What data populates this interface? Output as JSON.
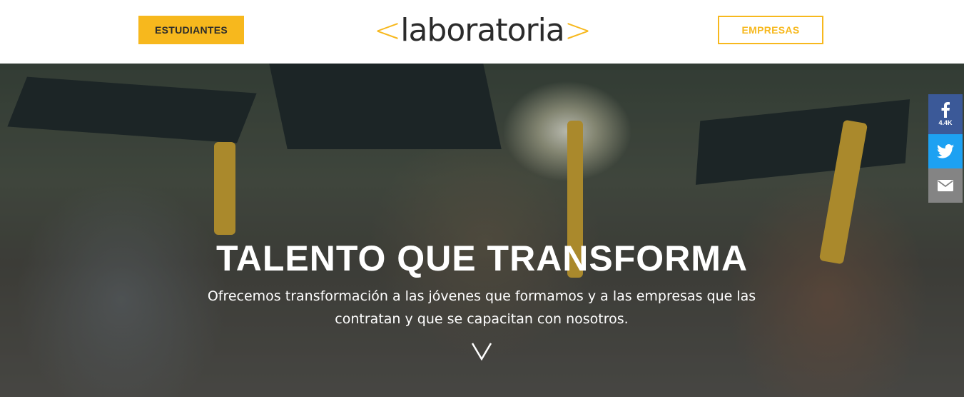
{
  "header": {
    "students_button": "ESTUDIANTES",
    "companies_button": "EMPRESAS",
    "logo": {
      "left_bracket": "<",
      "wordmark": "laboratoria",
      "right_bracket": ">"
    }
  },
  "hero": {
    "title": "TALENTO QUE TRANSFORMA",
    "subtitle": "Ofrecemos transformación a las jóvenes que formamos y a las empresas que las contratan y que se capacitan con nosotros.",
    "scroll_icon": "chevron-down-icon"
  },
  "share": {
    "facebook_count": "4.4K",
    "facebook_icon": "facebook-icon",
    "twitter_icon": "twitter-icon",
    "email_icon": "email-icon"
  },
  "colors": {
    "accent": "#f7b81d",
    "facebook": "#3b5998",
    "twitter": "#1da1f2",
    "email": "#848484"
  }
}
